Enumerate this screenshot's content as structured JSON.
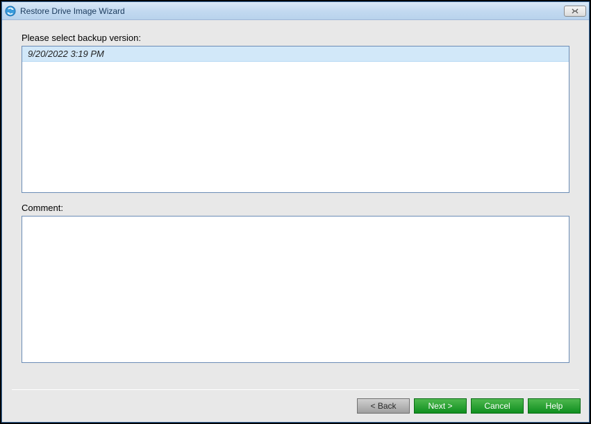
{
  "window": {
    "title": "Restore Drive Image Wizard"
  },
  "labels": {
    "select_version": "Please select backup version:",
    "comment": "Comment:"
  },
  "versions": [
    {
      "label": "9/20/2022 3:19 PM"
    }
  ],
  "comment_value": "",
  "buttons": {
    "back": "< Back",
    "next": "Next >",
    "cancel": "Cancel",
    "help": "Help"
  }
}
